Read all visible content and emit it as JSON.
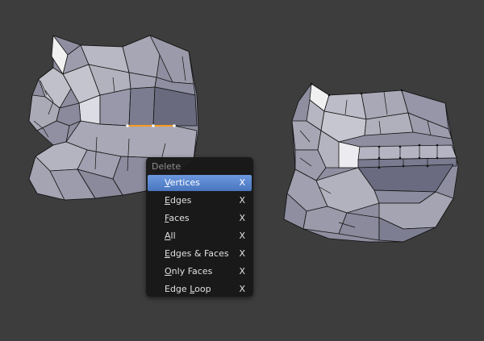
{
  "delete_menu": {
    "title": "Delete",
    "items": [
      {
        "mnemonic": "V",
        "rest": "ertices",
        "shortcut": "X",
        "active": true
      },
      {
        "mnemonic": "E",
        "rest": "dges",
        "shortcut": "X",
        "active": false
      },
      {
        "mnemonic": "F",
        "rest": "aces",
        "shortcut": "X",
        "active": false
      },
      {
        "mnemonic": "A",
        "rest": "ll",
        "shortcut": "X",
        "active": false
      },
      {
        "mnemonic": "E",
        "rest": "dges & Faces",
        "shortcut": "X",
        "active": false
      },
      {
        "mnemonic": "O",
        "rest": "nly Faces",
        "shortcut": "X",
        "active": false
      },
      {
        "pre": "Edge ",
        "mnemonic": "L",
        "rest": "oop",
        "shortcut": "X",
        "active": false
      }
    ]
  },
  "colors": {
    "viewport_bg": "#3d3d3d",
    "mesh_face": "#b1b1bd",
    "mesh_dark": "#5a5a6c",
    "selected_edge": "#ff9a1f",
    "menu_highlight": "#5680c2"
  }
}
